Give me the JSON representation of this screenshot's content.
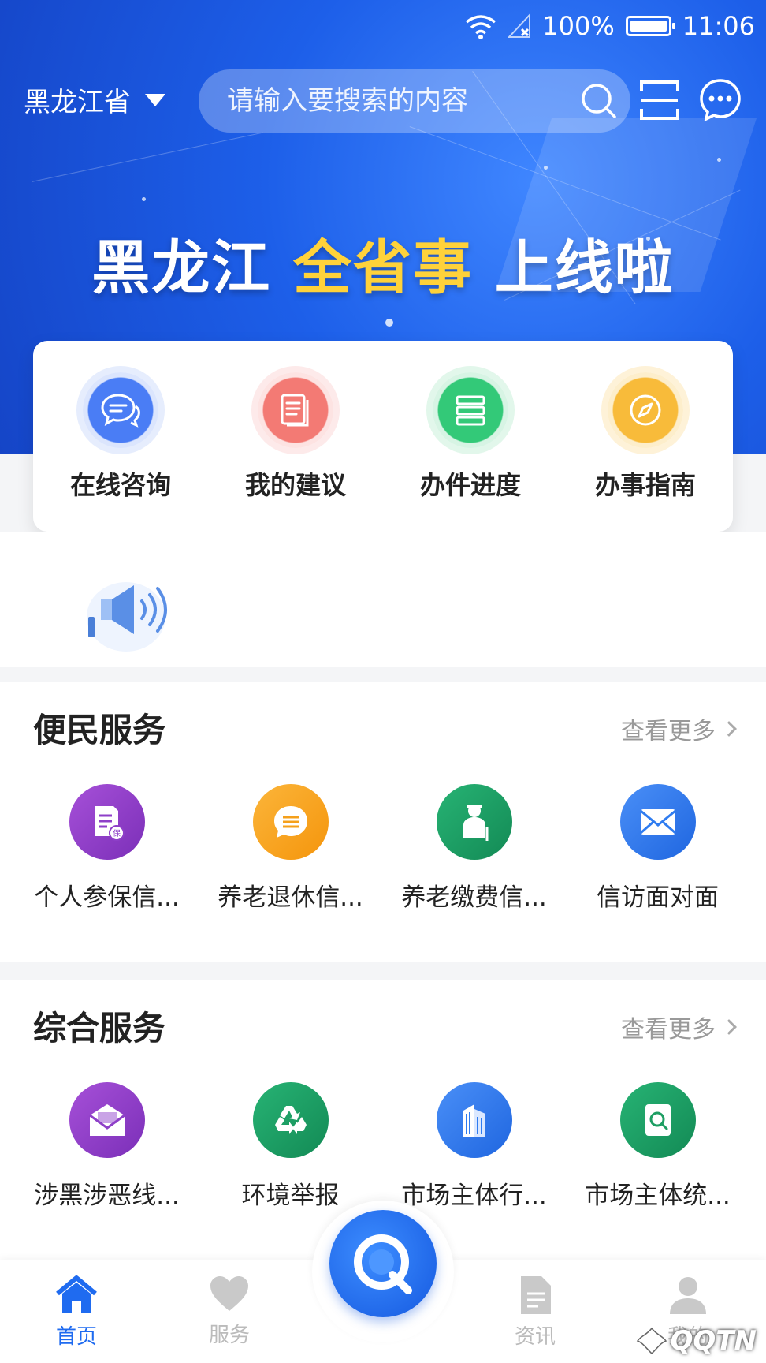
{
  "status_bar": {
    "battery": "100%",
    "time": "11:06"
  },
  "header": {
    "region": "黑龙江省",
    "search_placeholder": "请输入要搜索的内容"
  },
  "banner": {
    "slogan_part1": "黑龙江 ",
    "slogan_highlight": "全省事",
    "slogan_part2": " 上线啦"
  },
  "quick_actions": [
    {
      "label": "在线咨询",
      "icon": "chat-icon",
      "color": "#3f6ff2"
    },
    {
      "label": "我的建议",
      "icon": "document-icon",
      "color": "#f2706b"
    },
    {
      "label": "办件进度",
      "icon": "list-icon",
      "color": "#2ecb7a"
    },
    {
      "label": "办事指南",
      "icon": "compass-icon",
      "color": "#f7b733"
    }
  ],
  "convenience": {
    "title": "便民服务",
    "more": "查看更多",
    "items": [
      {
        "label": "个人参保信...",
        "icon": "insurance-doc-icon",
        "color": "#8e3fc8"
      },
      {
        "label": "养老退休信...",
        "icon": "message-icon",
        "color": "#f7a21b"
      },
      {
        "label": "养老缴费信...",
        "icon": "elderly-icon",
        "color": "#1e9e63"
      },
      {
        "label": "信访面对面",
        "icon": "mail-icon",
        "color": "#2f7cf0"
      }
    ]
  },
  "comprehensive": {
    "title": "综合服务",
    "more": "查看更多",
    "items": [
      {
        "label": "涉黑涉恶线...",
        "icon": "report-box-icon",
        "color": "#8e3fc8"
      },
      {
        "label": "环境举报",
        "icon": "recycle-icon",
        "color": "#1e9e63"
      },
      {
        "label": "市场主体行...",
        "icon": "building-icon",
        "color": "#2f7cf0"
      },
      {
        "label": "市场主体统...",
        "icon": "search-doc-icon",
        "color": "#1e9e63"
      }
    ]
  },
  "bottom_nav": [
    {
      "label": "首页",
      "icon": "home-icon",
      "active": true
    },
    {
      "label": "服务",
      "icon": "heart-icon",
      "active": false
    },
    {
      "label": "资讯",
      "icon": "news-icon",
      "active": false
    },
    {
      "label": "我的",
      "icon": "user-icon",
      "active": false
    }
  ],
  "watermark": "QQTN"
}
